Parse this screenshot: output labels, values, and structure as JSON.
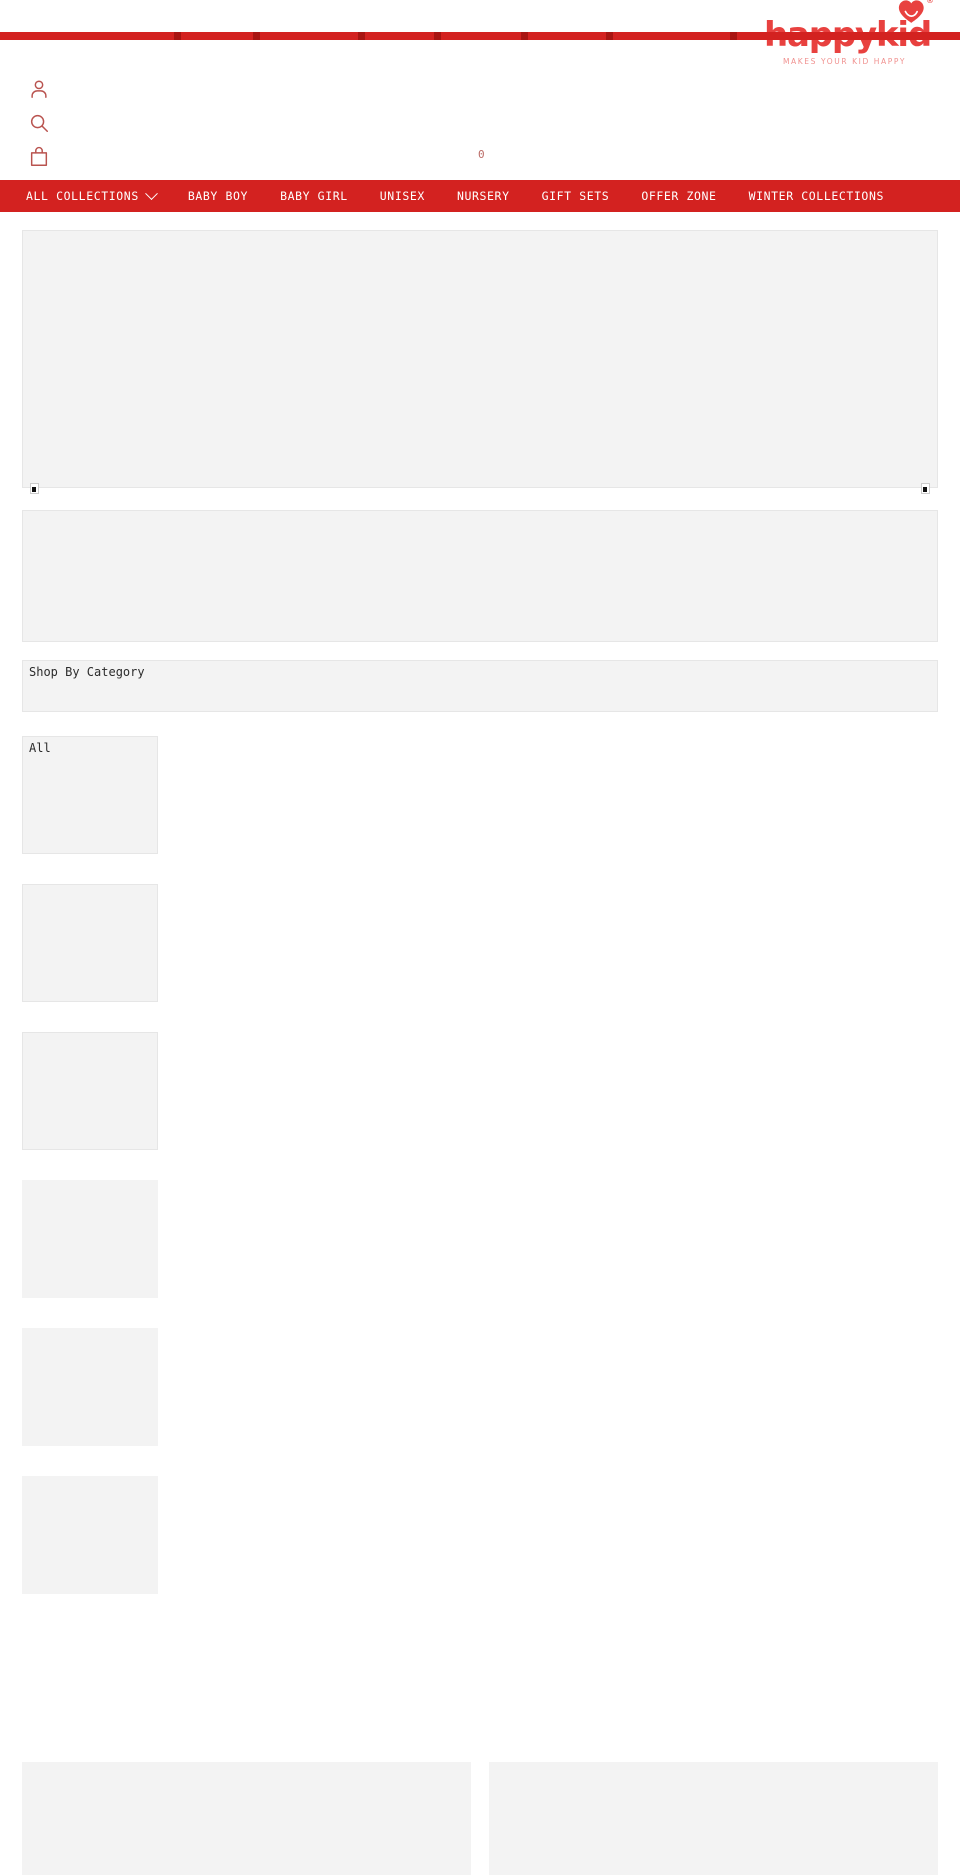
{
  "site": {
    "brand_name": "happykid",
    "tagline": "MAKES YOUR KID HAPPY",
    "registered_mark": "®",
    "brand_color": "#e8413f",
    "nav_color": "#d32220",
    "nav_tick_color": "#a81512",
    "icon_color": "#b9534f"
  },
  "header": {
    "icons": [
      {
        "name": "account-icon",
        "label": "Account"
      },
      {
        "name": "search-icon",
        "label": "Search"
      },
      {
        "name": "cart-icon",
        "label": "Cart"
      }
    ],
    "cart_count": "0"
  },
  "nav": {
    "items": [
      {
        "label": "ALL COLLECTIONS",
        "has_caret": true
      },
      {
        "label": "BABY BOY",
        "has_caret": false
      },
      {
        "label": "BABY GIRL",
        "has_caret": false
      },
      {
        "label": "UNISEX",
        "has_caret": false
      },
      {
        "label": "NURSERY",
        "has_caret": false
      },
      {
        "label": "GIFT SETS",
        "has_caret": false
      },
      {
        "label": "OFFER ZONE",
        "has_caret": false
      },
      {
        "label": "WINTER COLLECTIONS",
        "has_caret": false
      }
    ]
  },
  "main": {
    "hero_banner": {
      "alt": ""
    },
    "carousel_prev": {
      "alt": ""
    },
    "carousel_next": {
      "alt": ""
    },
    "promo_strip": {
      "alt": ""
    },
    "shop_by_category": {
      "alt": "Shop By Category"
    },
    "categories": [
      {
        "alt": "All",
        "bordered": true
      },
      {
        "alt": "",
        "bordered": true
      },
      {
        "alt": "",
        "bordered": true
      },
      {
        "alt": "",
        "bordered": false
      },
      {
        "alt": "",
        "bordered": false
      },
      {
        "alt": "",
        "bordered": false
      }
    ],
    "bottom_cards": [
      {
        "alt": ""
      },
      {
        "alt": ""
      }
    ]
  }
}
